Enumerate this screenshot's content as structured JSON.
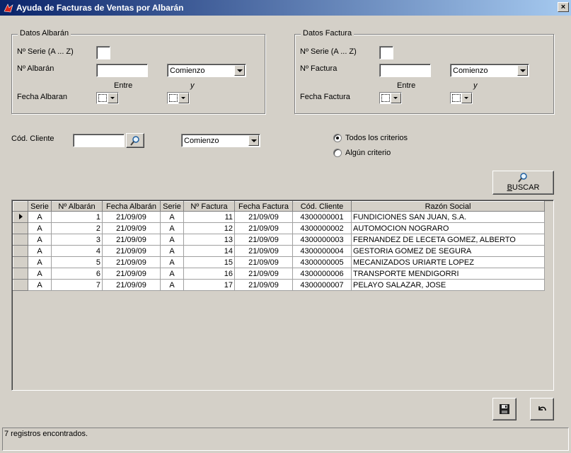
{
  "window": {
    "title": "Ayuda de Facturas de Ventas por Albarán",
    "close_glyph": "×"
  },
  "albaran": {
    "legend": "Datos  Albarán",
    "serie_label": "Nº Serie (A ... Z)",
    "serie_value": "",
    "numero_label": "Nº Albarán",
    "numero_value": "",
    "match_mode": "Comienzo",
    "entre_label": "Entre",
    "y_label": "y",
    "fecha_label": "Fecha Albaran"
  },
  "factura": {
    "legend": "Datos Factura",
    "serie_label": "Nº Serie (A ... Z)",
    "serie_value": "",
    "numero_label": "Nº Factura",
    "numero_value": "",
    "match_mode": "Comienzo",
    "entre_label": "Entre",
    "y_label": "y",
    "fecha_label": "Fecha Factura"
  },
  "cliente": {
    "label": "Cód. Cliente",
    "value": "",
    "match_mode": "Comienzo"
  },
  "criterios": {
    "todos": "Todos los criterios",
    "alguno": "Algún criterio",
    "selected": "todos"
  },
  "buscar": {
    "label": "BUSCAR",
    "icon": "magnifier-icon"
  },
  "grid": {
    "columns": [
      "Serie",
      "Nº Albarán",
      "Fecha Albarán",
      "Serie",
      "Nº Factura",
      "Fecha  Factura",
      "Cód. Cliente",
      "Razón Social"
    ],
    "selected_row": 0,
    "rows": [
      [
        "A",
        "1",
        "21/09/09",
        "A",
        "11",
        "21/09/09",
        "4300000001",
        "FUNDICIONES SAN JUAN, S.A."
      ],
      [
        "A",
        "2",
        "21/09/09",
        "A",
        "12",
        "21/09/09",
        "4300000002",
        "AUTOMOCION NOGRARO"
      ],
      [
        "A",
        "3",
        "21/09/09",
        "A",
        "13",
        "21/09/09",
        "4300000003",
        "FERNANDEZ DE LECETA GOMEZ, ALBERTO"
      ],
      [
        "A",
        "4",
        "21/09/09",
        "A",
        "14",
        "21/09/09",
        "4300000004",
        "GESTORIA GOMEZ DE SEGURA"
      ],
      [
        "A",
        "5",
        "21/09/09",
        "A",
        "15",
        "21/09/09",
        "4300000005",
        "MECANIZADOS URIARTE LOPEZ"
      ],
      [
        "A",
        "6",
        "21/09/09",
        "A",
        "16",
        "21/09/09",
        "4300000006",
        "TRANSPORTE MENDIGORRI"
      ],
      [
        "A",
        "7",
        "21/09/09",
        "A",
        "17",
        "21/09/09",
        "4300000007",
        "PELAYO SALAZAR, JOSE"
      ]
    ]
  },
  "actions": {
    "save_icon": "floppy-disk-icon",
    "undo_icon": "undo-arrow-icon"
  },
  "status": {
    "text": "7 registros encontrados."
  }
}
